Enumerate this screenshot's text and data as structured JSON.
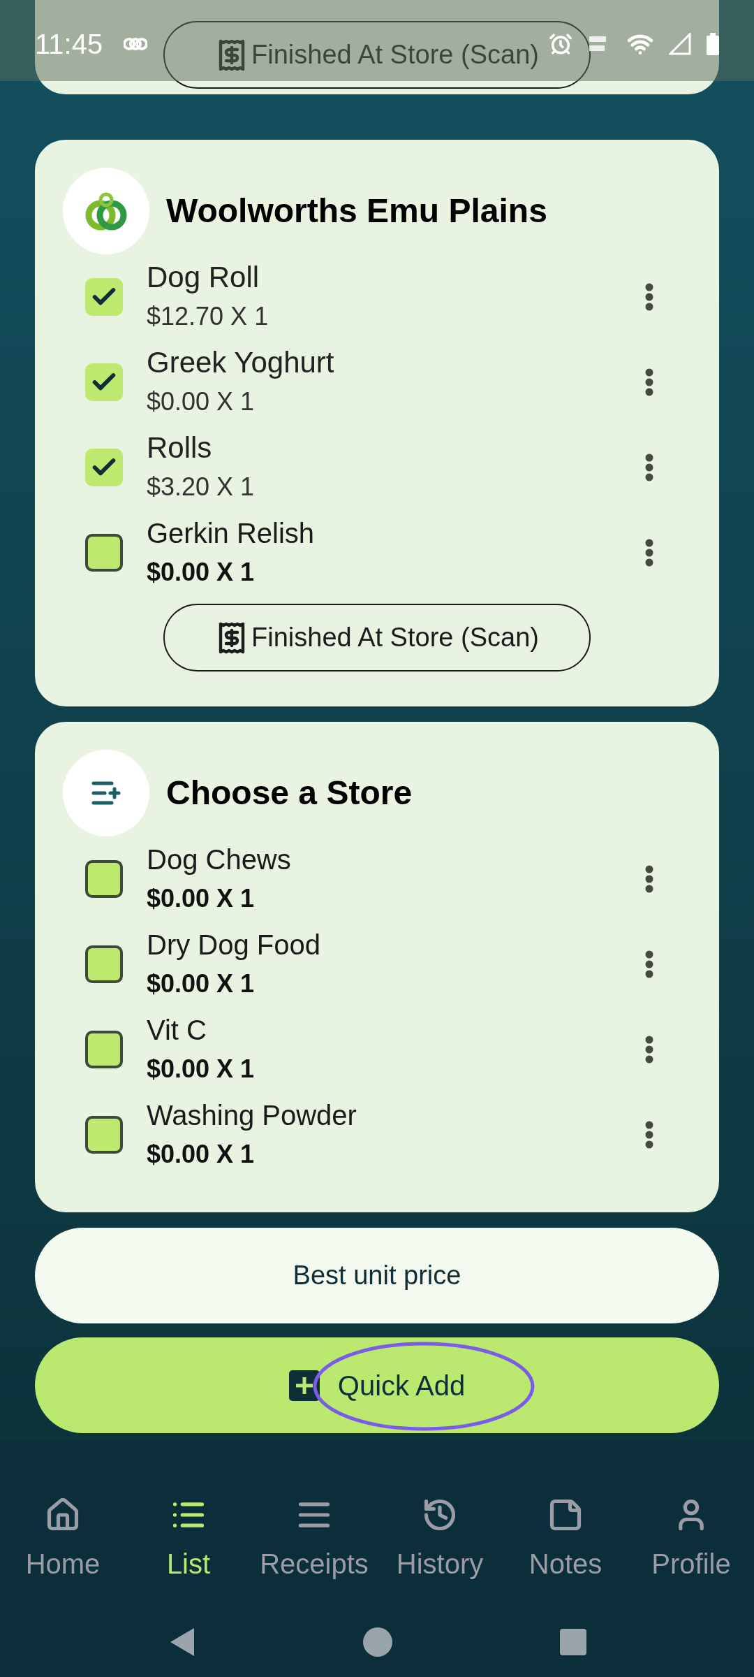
{
  "status_bar": {
    "time": "11:45"
  },
  "top_card": {
    "button": "Finished At Store (Scan)"
  },
  "stores": [
    {
      "kind": "store",
      "name": "Woolworths Emu Plains",
      "items": [
        {
          "name": "Dog Roll",
          "price": "$12.70 X 1",
          "checked": true
        },
        {
          "name": "Greek Yoghurt",
          "price": "$0.00 X 1",
          "checked": true
        },
        {
          "name": "Rolls",
          "price": "$3.20 X 1",
          "checked": true
        },
        {
          "name": "Gerkin Relish",
          "price": "$0.00 X 1",
          "checked": false
        }
      ],
      "button": "Finished At Store (Scan)"
    },
    {
      "kind": "unassigned",
      "name": "Choose a Store",
      "items": [
        {
          "name": "Dog Chews",
          "price": "$0.00 X 1",
          "checked": false
        },
        {
          "name": "Dry Dog Food",
          "price": "$0.00 X 1",
          "checked": false
        },
        {
          "name": "Vit C",
          "price": "$0.00 X 1",
          "checked": false
        },
        {
          "name": "Washing Powder",
          "price": "$0.00 X 1",
          "checked": false
        }
      ]
    }
  ],
  "best_price_button": "Best unit price",
  "quick_add": {
    "label": "Quick Add",
    "highlighted": true
  },
  "nav": [
    {
      "kind": "home",
      "label": "Home",
      "selected": false
    },
    {
      "kind": "list",
      "label": "List",
      "selected": true
    },
    {
      "kind": "receipts",
      "label": "Receipts",
      "selected": false
    },
    {
      "kind": "history",
      "label": "History",
      "selected": false
    },
    {
      "kind": "notes",
      "label": "Notes",
      "selected": false
    },
    {
      "kind": "profile",
      "label": "Profile",
      "selected": false
    }
  ]
}
